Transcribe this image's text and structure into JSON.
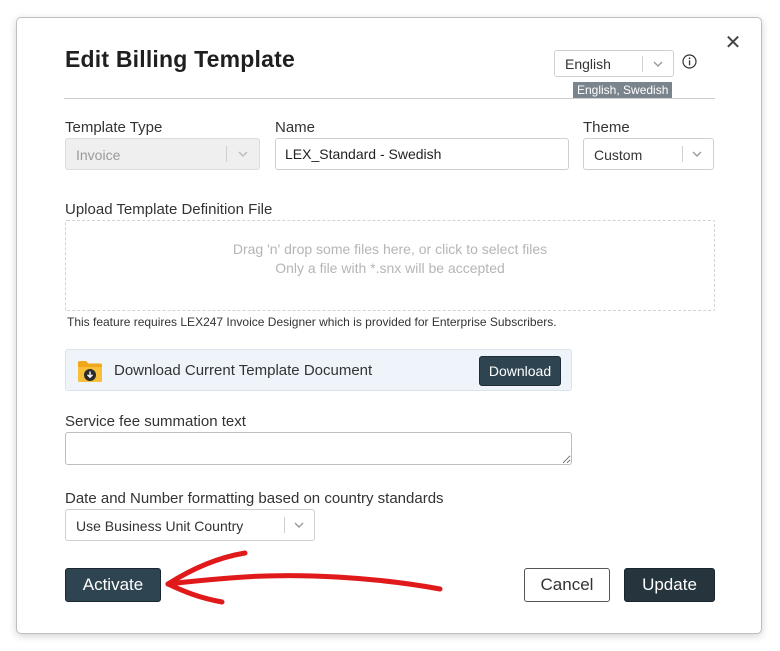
{
  "dialog": {
    "title": "Edit Billing Template",
    "close_icon": "close-icon"
  },
  "language": {
    "selected": "English",
    "tag": "English, Swedish",
    "info_icon": "info-icon"
  },
  "form": {
    "template_type": {
      "label": "Template Type",
      "value": "Invoice"
    },
    "name": {
      "label": "Name",
      "value": "LEX_Standard - Swedish"
    },
    "theme": {
      "label": "Theme",
      "value": "Custom"
    },
    "upload": {
      "label": "Upload Template Definition File",
      "drop_line1": "Drag 'n' drop some files here, or click to select files",
      "drop_line2": "Only a file with *.snx will be accepted",
      "note": "This feature requires LEX247 Invoice Designer which is provided for Enterprise Subscribers."
    },
    "download": {
      "text": "Download Current Template Document",
      "button": "Download",
      "icon": "folder-download-icon"
    },
    "service_fee": {
      "label": "Service fee summation text",
      "value": ""
    },
    "formatting": {
      "label": "Date and Number formatting based on country standards",
      "value": "Use Business Unit Country"
    }
  },
  "actions": {
    "activate": "Activate",
    "cancel": "Cancel",
    "update": "Update"
  },
  "colors": {
    "primary_button": "#2f4451",
    "annotation_arrow": "#e0191b",
    "download_bg": "#eef4fa"
  }
}
